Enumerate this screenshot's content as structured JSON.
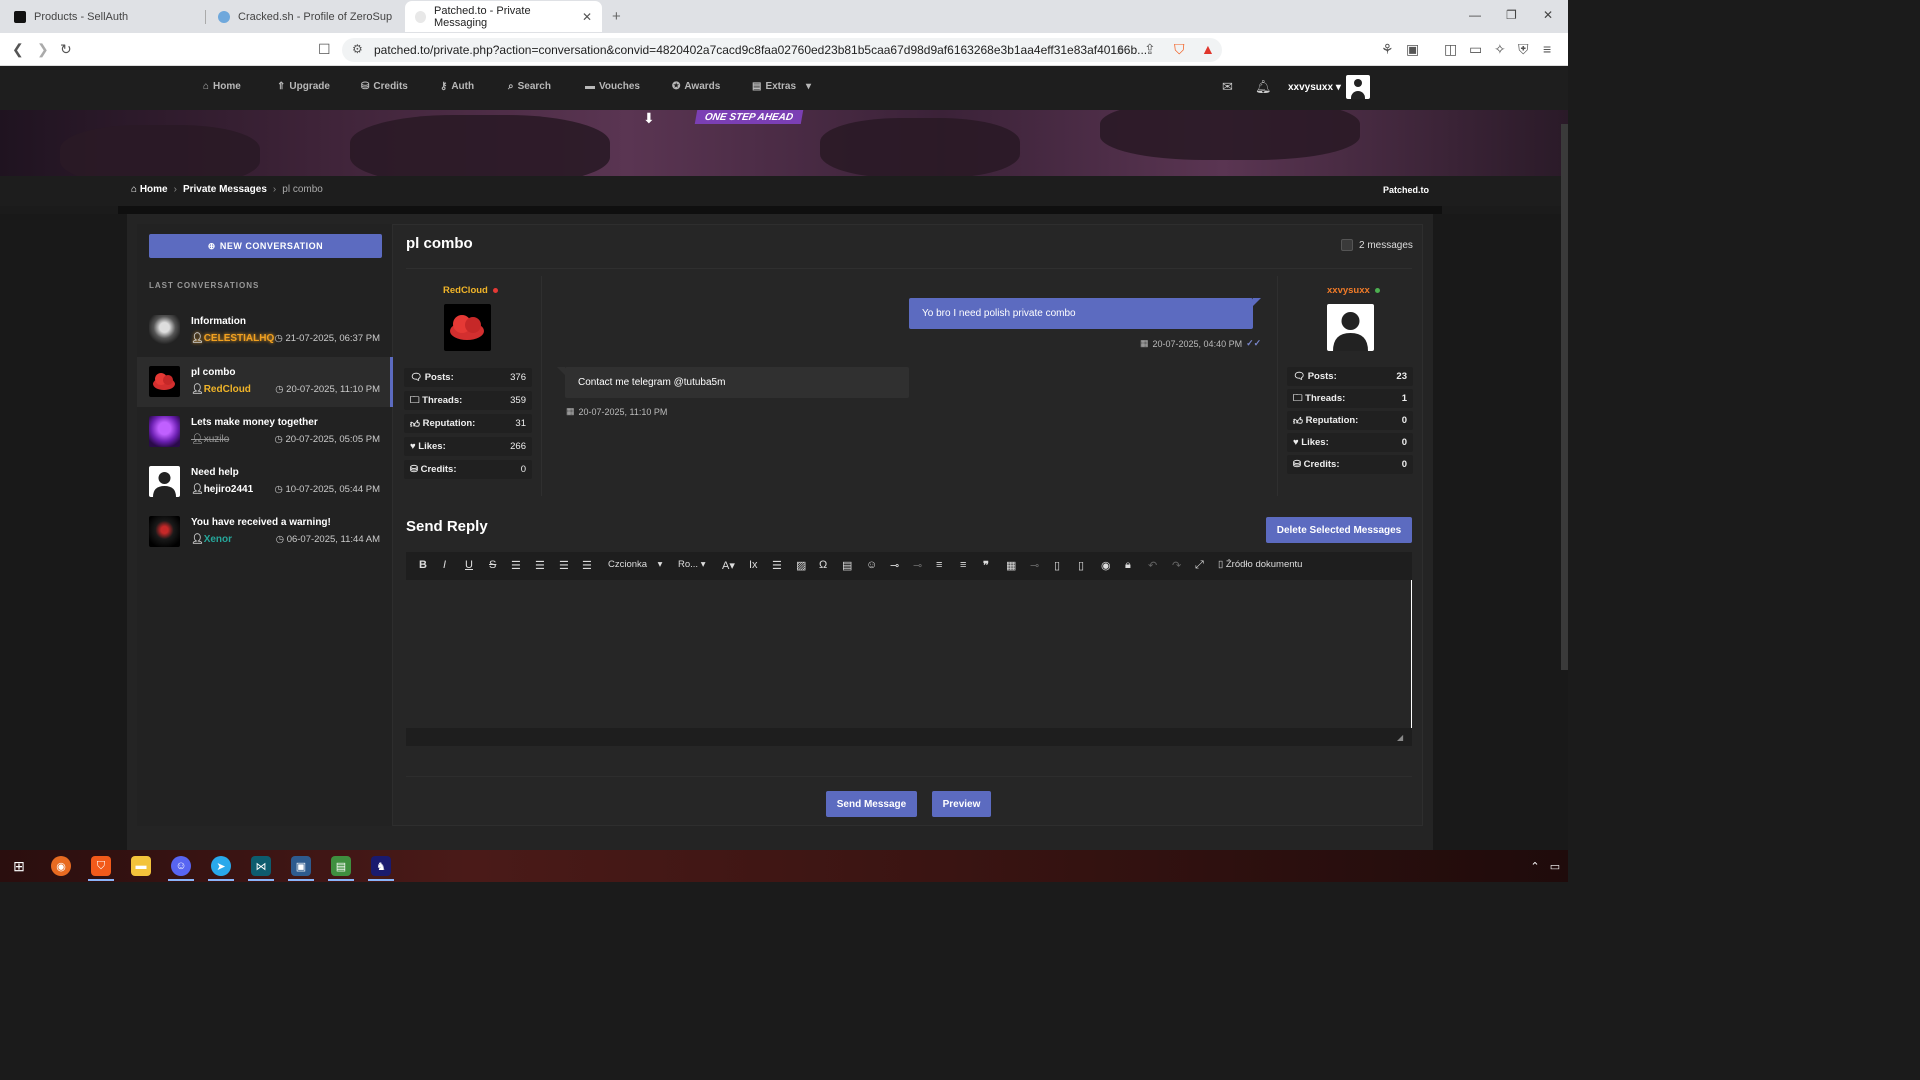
{
  "browser": {
    "tabs": [
      {
        "title": "Products - SellAuth"
      },
      {
        "title": "Cracked.sh - Profile of ZeroSup"
      },
      {
        "title": "Patched.to - Private Messaging"
      }
    ],
    "url": "patched.to/private.php?action=conversation&convid=4820402a7cacd9c8faa02760ed23b81b5caa67d98d9af6163268e3b1aa4eff31e83af40166b..."
  },
  "site_nav": {
    "items": [
      {
        "label": "Home",
        "icon": "home-icon"
      },
      {
        "label": "Upgrade",
        "icon": "upgrade-icon"
      },
      {
        "label": "Credits",
        "icon": "credits-icon"
      },
      {
        "label": "Auth",
        "icon": "key-icon"
      },
      {
        "label": "Search",
        "icon": "search-icon"
      },
      {
        "label": "Vouches",
        "icon": "vouches-icon"
      },
      {
        "label": "Awards",
        "icon": "award-icon"
      },
      {
        "label": "Extras",
        "icon": "extras-icon"
      }
    ],
    "username": "xxvysuxx"
  },
  "banner": {
    "tagline": "ONE STEP AHEAD"
  },
  "breadcrumb": {
    "home": "Home",
    "section": "Private Messages",
    "current": "pl combo",
    "site": "Patched.to"
  },
  "sidebar": {
    "new_conversation": "NEW CONVERSATION",
    "heading": "LAST CONVERSATIONS",
    "conversations": [
      {
        "title": "Information",
        "author": "CELESTIALHQ",
        "date": "21-07-2025, 06:37 PM"
      },
      {
        "title": "pl combo",
        "author": "RedCloud",
        "date": "20-07-2025, 11:10 PM"
      },
      {
        "title": "Lets make money together",
        "author": "xuzilo",
        "date": "20-07-2025, 05:05 PM"
      },
      {
        "title": "Need help",
        "author": "hejiro2441",
        "date": "10-07-2025, 05:44 PM"
      },
      {
        "title": "You have received a warning!",
        "author": "Xenor",
        "date": "06-07-2025, 11:44 AM"
      }
    ]
  },
  "conversation": {
    "title": "pl combo",
    "message_count": "2 messages",
    "left_user": {
      "name": "RedCloud",
      "stats": [
        {
          "label": "Posts:",
          "value": "376"
        },
        {
          "label": "Threads:",
          "value": "359"
        },
        {
          "label": "Reputation:",
          "value": "31"
        },
        {
          "label": "Likes:",
          "value": "266"
        },
        {
          "label": "Credits:",
          "value": "0"
        }
      ]
    },
    "right_user": {
      "name": "xxvysuxx",
      "stats": [
        {
          "label": "Posts:",
          "value": "23"
        },
        {
          "label": "Threads:",
          "value": "1"
        },
        {
          "label": "Reputation:",
          "value": "0"
        },
        {
          "label": "Likes:",
          "value": "0"
        },
        {
          "label": "Credits:",
          "value": "0"
        }
      ]
    },
    "messages": [
      {
        "text": "Yo bro I need polish private combo",
        "time": "20-07-2025, 04:40 PM",
        "direction": "out"
      },
      {
        "text": "Contact me telegram @tutuba5m",
        "time": "20-07-2025, 11:10 PM",
        "direction": "in"
      }
    ]
  },
  "reply": {
    "title": "Send Reply",
    "delete_selected": "Delete Selected Messages",
    "font_select": "Czcionka",
    "size_select": "Ro...",
    "source_button": "Źródło dokumentu",
    "send": "Send Message",
    "preview": "Preview"
  },
  "colors": {
    "accent": "#5c6bc0",
    "redcloud": "#f0b429",
    "online": "#4caf50",
    "offline": "#e53935"
  }
}
